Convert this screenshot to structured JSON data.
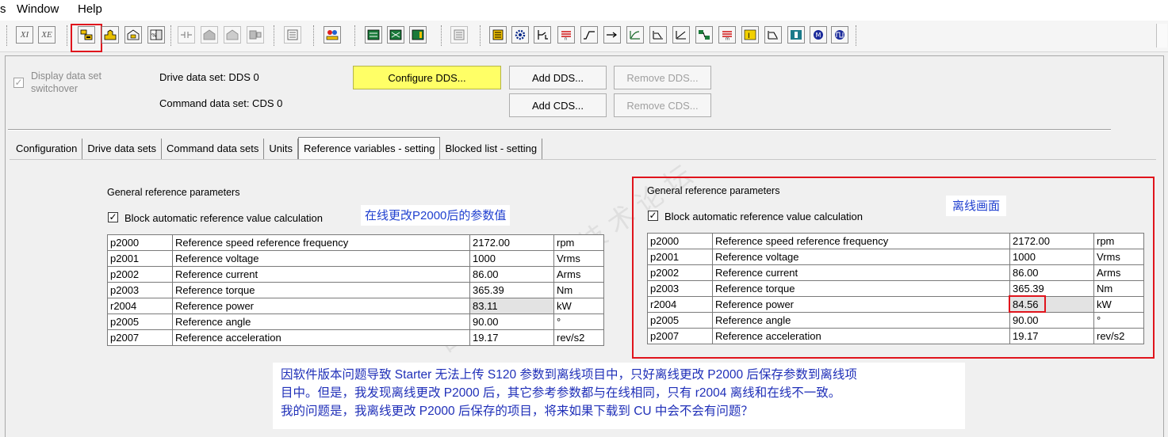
{
  "menu": {
    "partial": "s",
    "window": "Window",
    "help": "Help"
  },
  "toolbar": {
    "icons": [
      "xi-icon",
      "xe-icon",
      "dds-select-icon",
      "upload-icon",
      "download-icon",
      "compare-icon",
      "join-icon",
      "load-icon",
      "save-icon",
      "online-icon",
      "table-icon",
      "person-icon",
      "screen-icon",
      "screen2-icon",
      "screen3-icon",
      "list-icon",
      "card-icon",
      "gear-icon",
      "relay-icon",
      "filter-icon",
      "ramp-icon",
      "arrow-icon",
      "curve-icon",
      "graph1-icon",
      "graph2-icon",
      "graph3-icon",
      "io-icon",
      "brake-icon",
      "limit-icon",
      "limit2-icon",
      "drive-icon",
      "motor-icon",
      "pulse-icon"
    ],
    "xi_label": "XI",
    "xe_label": "XE"
  },
  "dataset": {
    "switchover_label": "Display data set switchover",
    "switchover_line1": "Display data set",
    "switchover_line2": "switchover",
    "drive_data_set": "Drive data set: DDS 0",
    "command_data_set": "Command data set: CDS 0",
    "configure_dds": "Configure DDS...",
    "add_dds": "Add DDS...",
    "remove_dds": "Remove DDS...",
    "add_cds": "Add CDS...",
    "remove_cds": "Remove CDS..."
  },
  "tabs": [
    {
      "label": "Configuration",
      "active": false
    },
    {
      "label": "Drive data sets",
      "active": false
    },
    {
      "label": "Command data sets",
      "active": false
    },
    {
      "label": "Units",
      "active": false
    },
    {
      "label": "Reference variables - setting",
      "active": true
    },
    {
      "label": "Blocked list - setting",
      "active": false
    }
  ],
  "online": {
    "group_title": "General reference parameters",
    "block_auto_label": "Block automatic reference value calculation",
    "block_auto_checked": true,
    "annotation": "在线更改P2000后的参数值",
    "rows": [
      {
        "param": "p2000",
        "name": "Reference speed reference frequency",
        "value": "2172.00",
        "unit": "rpm",
        "readonly": false
      },
      {
        "param": "p2001",
        "name": "Reference voltage",
        "value": "1000",
        "unit": "Vrms",
        "readonly": false
      },
      {
        "param": "p2002",
        "name": "Reference current",
        "value": "86.00",
        "unit": "Arms",
        "readonly": false
      },
      {
        "param": "p2003",
        "name": "Reference torque",
        "value": "365.39",
        "unit": "Nm",
        "readonly": false
      },
      {
        "param": "r2004",
        "name": "Reference power",
        "value": "83.11",
        "unit": "kW",
        "readonly": true
      },
      {
        "param": "p2005",
        "name": "Reference angle",
        "value": "90.00",
        "unit": "°",
        "readonly": false
      },
      {
        "param": "p2007",
        "name": "Reference acceleration",
        "value": "19.17",
        "unit": "rev/s2",
        "readonly": false
      }
    ]
  },
  "offline": {
    "group_title": "General reference parameters",
    "block_auto_label": "Block automatic reference value calculation",
    "block_auto_checked": true,
    "annotation": "离线画面",
    "rows": [
      {
        "param": "p2000",
        "name": "Reference speed reference frequency",
        "value": "2172.00",
        "unit": "rpm",
        "readonly": false
      },
      {
        "param": "p2001",
        "name": "Reference voltage",
        "value": "1000",
        "unit": "Vrms",
        "readonly": false
      },
      {
        "param": "p2002",
        "name": "Reference current",
        "value": "86.00",
        "unit": "Arms",
        "readonly": false
      },
      {
        "param": "p2003",
        "name": "Reference torque",
        "value": "365.39",
        "unit": "Nm",
        "readonly": false
      },
      {
        "param": "r2004",
        "name": "Reference power",
        "value": "84.56",
        "unit": "kW",
        "readonly": true
      },
      {
        "param": "p2005",
        "name": "Reference angle",
        "value": "90.00",
        "unit": "°",
        "readonly": false
      },
      {
        "param": "p2007",
        "name": "Reference acceleration",
        "value": "19.17",
        "unit": "rev/s2",
        "readonly": false
      }
    ]
  },
  "question": {
    "line1": "因软件版本问题导致 Starter 无法上传 S120 参数到离线项目中，只好离线更改 P2000 后保存参数到离线项",
    "line2": "目中。但是，我发现离线更改 P2000 后，其它参考参数都与在线相同，只有 r2004 离线和在线不一致。",
    "line3": "我的问题是，我离线更改 P2000 后保存的项目，将来如果下载到 CU 中会不会有问题？"
  },
  "colors": {
    "accent_red": "#e0141c",
    "annotation_blue": "#1f3fcf",
    "configure_yellow": "#ffff66"
  }
}
